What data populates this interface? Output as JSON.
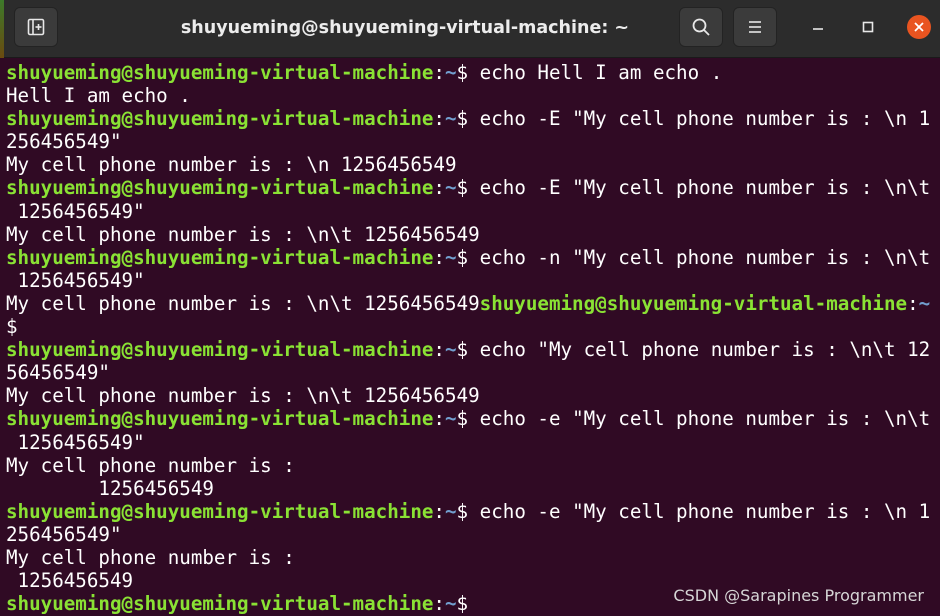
{
  "window": {
    "title": "shuyueming@shuyueming-virtual-machine: ~"
  },
  "icons": {
    "new_tab": "new-tab-icon",
    "search": "search-icon",
    "menu": "hamburger-menu-icon",
    "minimize": "minimize-icon",
    "maximize": "maximize-icon",
    "close": "close-icon"
  },
  "colors": {
    "terminal_bg": "#300a24",
    "prompt_user": "#8ae234",
    "prompt_path": "#729fcf",
    "titlebar_bg": "#2c2c2c",
    "close_button": "#e95420"
  },
  "prompt": {
    "user_host": "shuyueming@shuyueming-virtual-machine",
    "colon": ":",
    "path": "~",
    "symbol": "$"
  },
  "terminal": {
    "lines": [
      {
        "type": "prompt",
        "text": " echo Hell I am echo ."
      },
      {
        "type": "output",
        "text": "Hell I am echo ."
      },
      {
        "type": "prompt",
        "text": " echo -E \"My cell phone number is : \\n 1"
      },
      {
        "type": "output",
        "text": "256456549\""
      },
      {
        "type": "output",
        "text": "My cell phone number is : \\n 1256456549"
      },
      {
        "type": "prompt",
        "text": " echo -E \"My cell phone number is : \\n\\t"
      },
      {
        "type": "output",
        "text": " 1256456549\""
      },
      {
        "type": "output",
        "text": "My cell phone number is : \\n\\t 1256456549"
      },
      {
        "type": "prompt",
        "text": " echo -n \"My cell phone number is : \\n\\t"
      },
      {
        "type": "output",
        "text": " 1256456549\""
      },
      {
        "type": "mixed",
        "text": "My cell phone number is : \\n\\t 1256456549",
        "suffix_path": "~"
      },
      {
        "type": "output",
        "text": "$"
      },
      {
        "type": "prompt",
        "text": " echo \"My cell phone number is : \\n\\t 12"
      },
      {
        "type": "output",
        "text": "56456549\""
      },
      {
        "type": "output",
        "text": "My cell phone number is : \\n\\t 1256456549"
      },
      {
        "type": "prompt",
        "text": " echo -e \"My cell phone number is : \\n\\t"
      },
      {
        "type": "output",
        "text": " 1256456549\""
      },
      {
        "type": "output",
        "text": "My cell phone number is :"
      },
      {
        "type": "output",
        "text": "        1256456549"
      },
      {
        "type": "prompt",
        "text": " echo -e \"My cell phone number is : \\n 1"
      },
      {
        "type": "output",
        "text": "256456549\""
      },
      {
        "type": "output",
        "text": "My cell phone number is :"
      },
      {
        "type": "output",
        "text": " 1256456549"
      },
      {
        "type": "prompt",
        "text": ""
      }
    ]
  },
  "watermark": "CSDN @Sarapines Programmer"
}
